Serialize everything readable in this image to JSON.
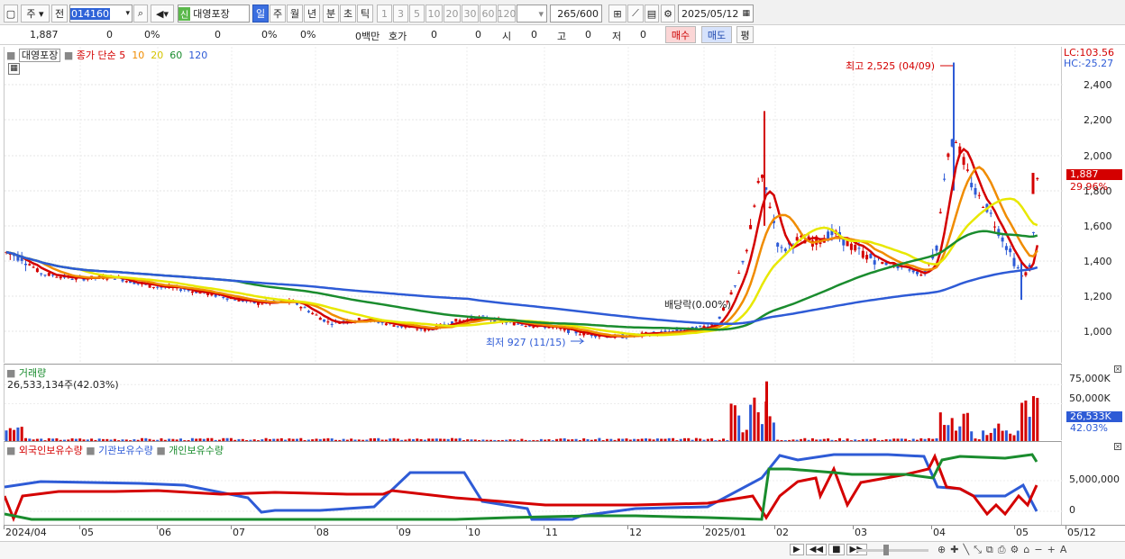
{
  "toolbar": {
    "market": "주",
    "prev": "전",
    "code": "014160",
    "name_badge": "신",
    "name": "대영포장",
    "periods": [
      "일",
      "주",
      "월",
      "년",
      "분",
      "초",
      "틱"
    ],
    "ranges": [
      "1",
      "3",
      "5",
      "10",
      "20",
      "30",
      "60",
      "120"
    ],
    "count": "265",
    "total": "/600",
    "date": "2025/05/12"
  },
  "quote": {
    "price": "1,887",
    "change": "0",
    "rate": "0%",
    "volume": "0",
    "vol_rate": "0%",
    "vol_rate2": "0%",
    "amount": "0백만",
    "hoga_label": "호가",
    "hoga": "0",
    "zero": "0",
    "open_label": "시",
    "open": "0",
    "high_label": "고",
    "high": "0",
    "low_label": "저",
    "low": "0",
    "buy": "매수",
    "sell": "매도",
    "flat": "평"
  },
  "price_panel": {
    "stock_tag": "대영포장",
    "ma_label": "종가 단순",
    "ma_periods": [
      "5",
      "10",
      "20",
      "60",
      "120"
    ],
    "ma_colors": [
      "#d40000",
      "#f08c00",
      "#e8e800",
      "#1a8c2e",
      "#2e5bd6"
    ],
    "lc": "LC:103.56",
    "hc": "HC:-25.27",
    "y_ticks": [
      "2,400",
      "2,200",
      "2,000",
      "1,800",
      "1,600",
      "1,400",
      "1,200",
      "1,000"
    ],
    "current_price": "1,887",
    "current_rate": "29.96%",
    "high_annot": "최고 2,525 (04/09)",
    "low_annot": "최저 927 (11/15)",
    "dividend_annot": "배당락(0.00%)"
  },
  "volume_panel": {
    "title": "거래량",
    "value": "26,533,134주(42.03%)",
    "y_ticks": [
      "75,000K",
      "50,000K"
    ],
    "current": "26,533K",
    "current_rate": "42.03%"
  },
  "holding_panel": {
    "series_names": [
      "외국인보유수량",
      "기관보유수량",
      "개인보유수량"
    ],
    "series_colors": [
      "#d40000",
      "#2e5bd6",
      "#1a8c2e"
    ],
    "y_ticks": [
      "5,000,000",
      "0"
    ]
  },
  "x_axis": [
    "2024/04",
    "05",
    "06",
    "07",
    "08",
    "09",
    "10",
    "11",
    "12",
    "2025/01",
    "02",
    "03",
    "04",
    "05",
    "05/12"
  ]
}
